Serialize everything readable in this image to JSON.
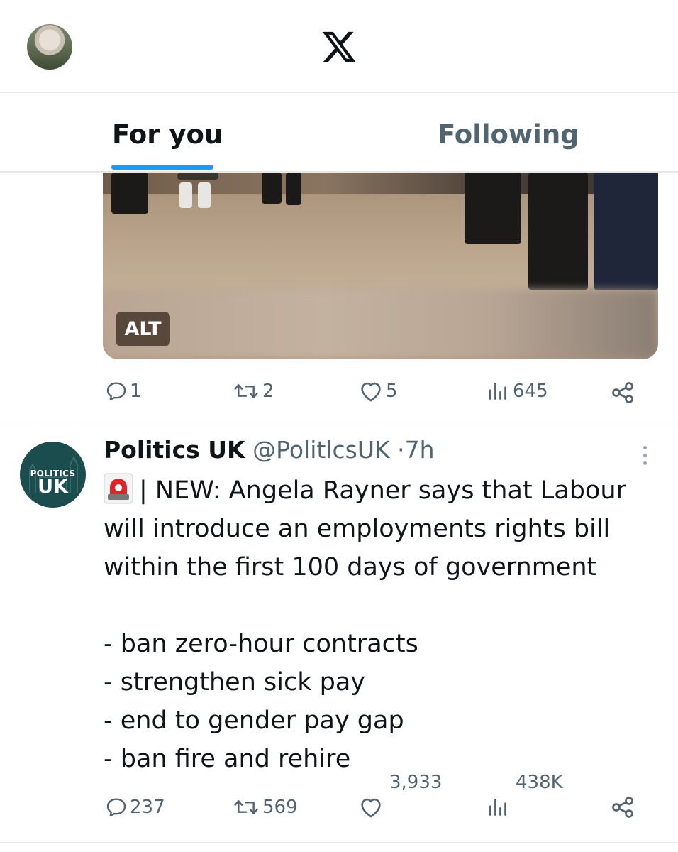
{
  "header": {
    "logo_icon": "x-logo-icon"
  },
  "tabs": [
    {
      "label": "For you",
      "active": true
    },
    {
      "label": "Following",
      "active": false
    }
  ],
  "post1": {
    "media_alt_badge": "ALT",
    "actions": {
      "replies": "1",
      "reposts": "2",
      "likes": "5",
      "views": "645"
    }
  },
  "post2": {
    "avatar": {
      "line1": "POLITICS",
      "line2": "UK"
    },
    "name": "Politics UK",
    "handle": "@PolitlcsUK",
    "separator": "·",
    "time": "7h",
    "text_lines": [
      "| NEW: Angela Rayner says that Labour",
      "will introduce an employments rights bill",
      "within the first 100 days of government",
      "",
      "- ban zero-hour contracts",
      "- strengthen sick pay",
      "- end to gender pay gap",
      "- ban fire and rehire"
    ],
    "actions": {
      "replies": "237",
      "reposts": "569",
      "likes": "3,933",
      "views": "438K"
    }
  },
  "colors": {
    "accent": "#1d9bf0",
    "text": "#0f1419",
    "secondary": "#536471",
    "brand_avatar": "#1b4d4f"
  }
}
